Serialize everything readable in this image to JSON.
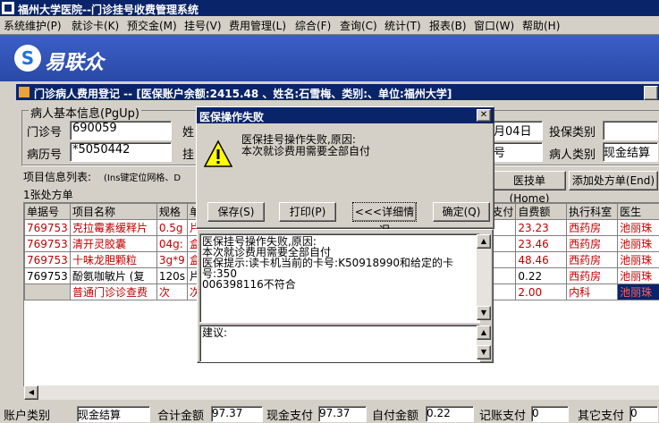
{
  "app_title": "福州大学医院--门诊挂号收费管理系统",
  "menu": [
    "系统维护(P)",
    "就诊卡(K)",
    "预交金(M)",
    "挂号(V)",
    "费用管理(L)",
    "综合(F)",
    "查询(C)",
    "统计(T)",
    "报表(B)",
    "窗口(W)",
    "帮助(H)"
  ],
  "brand": "易联众",
  "window": {
    "title": "门诊病人费用登记 -- [医保账户余额:2415.48 、姓名:石雪梅、类别:、单位:福州大学]"
  },
  "patient": {
    "section_title": "病人基本信息(PgUp)",
    "outpatient_no_label": "门诊号",
    "outpatient_no": "690059",
    "record_no_label": "病历号",
    "record_no": "*5050442",
    "partial_label_1": "姓",
    "partial_label_2": "挂",
    "partial_label_3": "号",
    "date_partial": "月04日",
    "insurance_type_label": "投保类别",
    "patient_type_label": "病人类别",
    "patient_type": "现金结算"
  },
  "items": {
    "list_label": "项目信息列表:",
    "list_hint": "(Ins键定位网格、D",
    "count_label": "1张处方单",
    "btn_doctor_order": "医技单(Home)",
    "btn_add_rx": "添加处方单(End)",
    "columns": [
      "单据号",
      "项目名称",
      "规格",
      "单",
      "支付",
      "自费额",
      "执行科室",
      "医生"
    ],
    "rows": [
      {
        "id": "769753",
        "name": "克拉霉素缓释片",
        "spec": "0.5g",
        "unit": "片",
        "pay": "",
        "self": "23.23",
        "dept": "西药房",
        "doctor": "池丽珠",
        "red": true
      },
      {
        "id": "769753",
        "name": "清开灵胶囊",
        "spec": "04g:",
        "unit": "盒",
        "pay": "",
        "self": "23.46",
        "dept": "西药房",
        "doctor": "池丽珠",
        "red": true
      },
      {
        "id": "769753",
        "name": "十味龙胆颗粒",
        "spec": "3g*9",
        "unit": "盒",
        "pay": "",
        "self": "48.46",
        "dept": "西药房",
        "doctor": "池丽珠",
        "red": true
      },
      {
        "id": "769753",
        "name": "酚氨咖敏片 (复",
        "spec": "120s",
        "unit": "片",
        "pay": "",
        "self": "0.22",
        "dept": "西药房",
        "doctor": "池丽珠",
        "red": false
      },
      {
        "id": "",
        "name": "普通门诊诊查费",
        "spec": "次",
        "unit": "次",
        "pay": "",
        "self": "2.00",
        "dept": "内科",
        "doctor": "池丽珠",
        "red": true
      }
    ]
  },
  "dialog": {
    "title": "医保操作失败",
    "message_line1": "医保挂号操作失败,原因:",
    "message_line2": "本次就诊费用需要全部自付",
    "btn_save": "保存(S)",
    "btn_print": "打印(P)",
    "btn_details": "<<<详细情况",
    "btn_ok": "确定(Q)"
  },
  "details": {
    "line1": "医保挂号操作失败,原因:",
    "line2": "本次就诊费用需要全部自付",
    "line3": "医保提示:读卡机当前的卡号:K50918990和给定的卡号:350",
    "line4": "006398116不符合",
    "suggestion_label": "建议:"
  },
  "footer": {
    "account_label": "账户类别",
    "account_value": "现金结算",
    "total_label": "合计金额",
    "total_value": "97.37",
    "cash_label": "现金支付",
    "cash_value": "97.37",
    "self_label": "自付金额",
    "self_value": "0.22",
    "fund_label": "记账支付",
    "fund_value": "0",
    "other_label": "其它支付",
    "other_value": "0"
  }
}
